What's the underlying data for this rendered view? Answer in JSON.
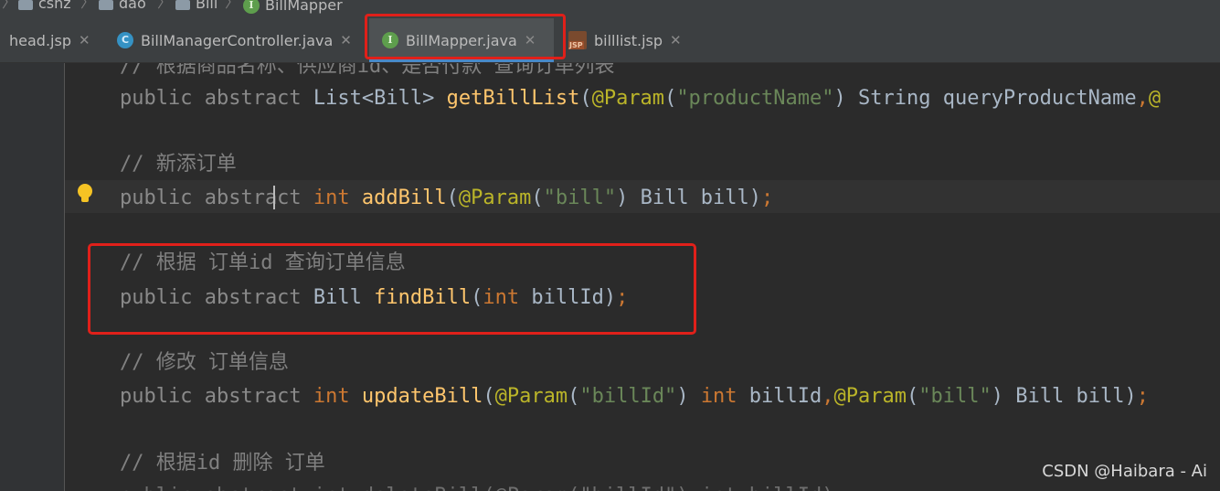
{
  "breadcrumb": {
    "items": [
      "csnz",
      "dao",
      "Bill",
      "BillMapper"
    ]
  },
  "tabs": [
    {
      "label": "head.jsp",
      "icon": "jsp-file-icon"
    },
    {
      "label": "BillManagerController.java",
      "icon": "class-icon"
    },
    {
      "label": "BillMapper.java",
      "icon": "interface-icon",
      "active": true
    },
    {
      "label": "billlist.jsp",
      "icon": "jsp-file-icon"
    }
  ],
  "icon_letters": {
    "class": "C",
    "interface": "I",
    "jsp": "JSP"
  },
  "code": {
    "line1": {
      "text": "// 根据商品名称、供应商id、是否付款 查询订单列表"
    },
    "line2": {
      "mod": "public abstract ",
      "type": "List<Bill> ",
      "fn": "getBillList",
      "p1": "(",
      "ann": "@Param",
      "p2": "(",
      "str": "\"productName\"",
      "p3": ") String queryProductName",
      "comma": ",",
      "ann2": "@"
    },
    "line3": {
      "text": "// 新添订单"
    },
    "line4": {
      "mod": "public abstract ",
      "kw": "int ",
      "fn": "addBill",
      "p1": "(",
      "ann": "@Param",
      "p2": "(",
      "str": "\"bill\"",
      "p3": ") Bill bill)",
      "semi": ";"
    },
    "line5": {
      "text": "// 根据 订单id 查询订单信息"
    },
    "line6": {
      "mod": "public abstract ",
      "type": "Bill ",
      "fn": "findBill",
      "p1": "(",
      "kw": "int",
      "p2": " billId)",
      "semi": ";"
    },
    "line7": {
      "text": "// 修改 订单信息"
    },
    "line8": {
      "mod": "public abstract ",
      "kw": "int ",
      "fn": "updateBill",
      "p1": "(",
      "ann": "@Param",
      "p2": "(",
      "str": "\"billId\"",
      "p3": ") ",
      "kw2": "int",
      "p4": " billId",
      "comma": ",",
      "ann2": "@Param",
      "p5": "(",
      "str2": "\"bill\"",
      "p6": ") Bill bill)",
      "semi": ";"
    },
    "line9": {
      "text": "// 根据id 删除 订单"
    },
    "line10": {
      "text": "public abstract int deleteBill(@Param(\"billId\") int billId);"
    }
  },
  "watermark": "CSDN @Haibara - Ai"
}
